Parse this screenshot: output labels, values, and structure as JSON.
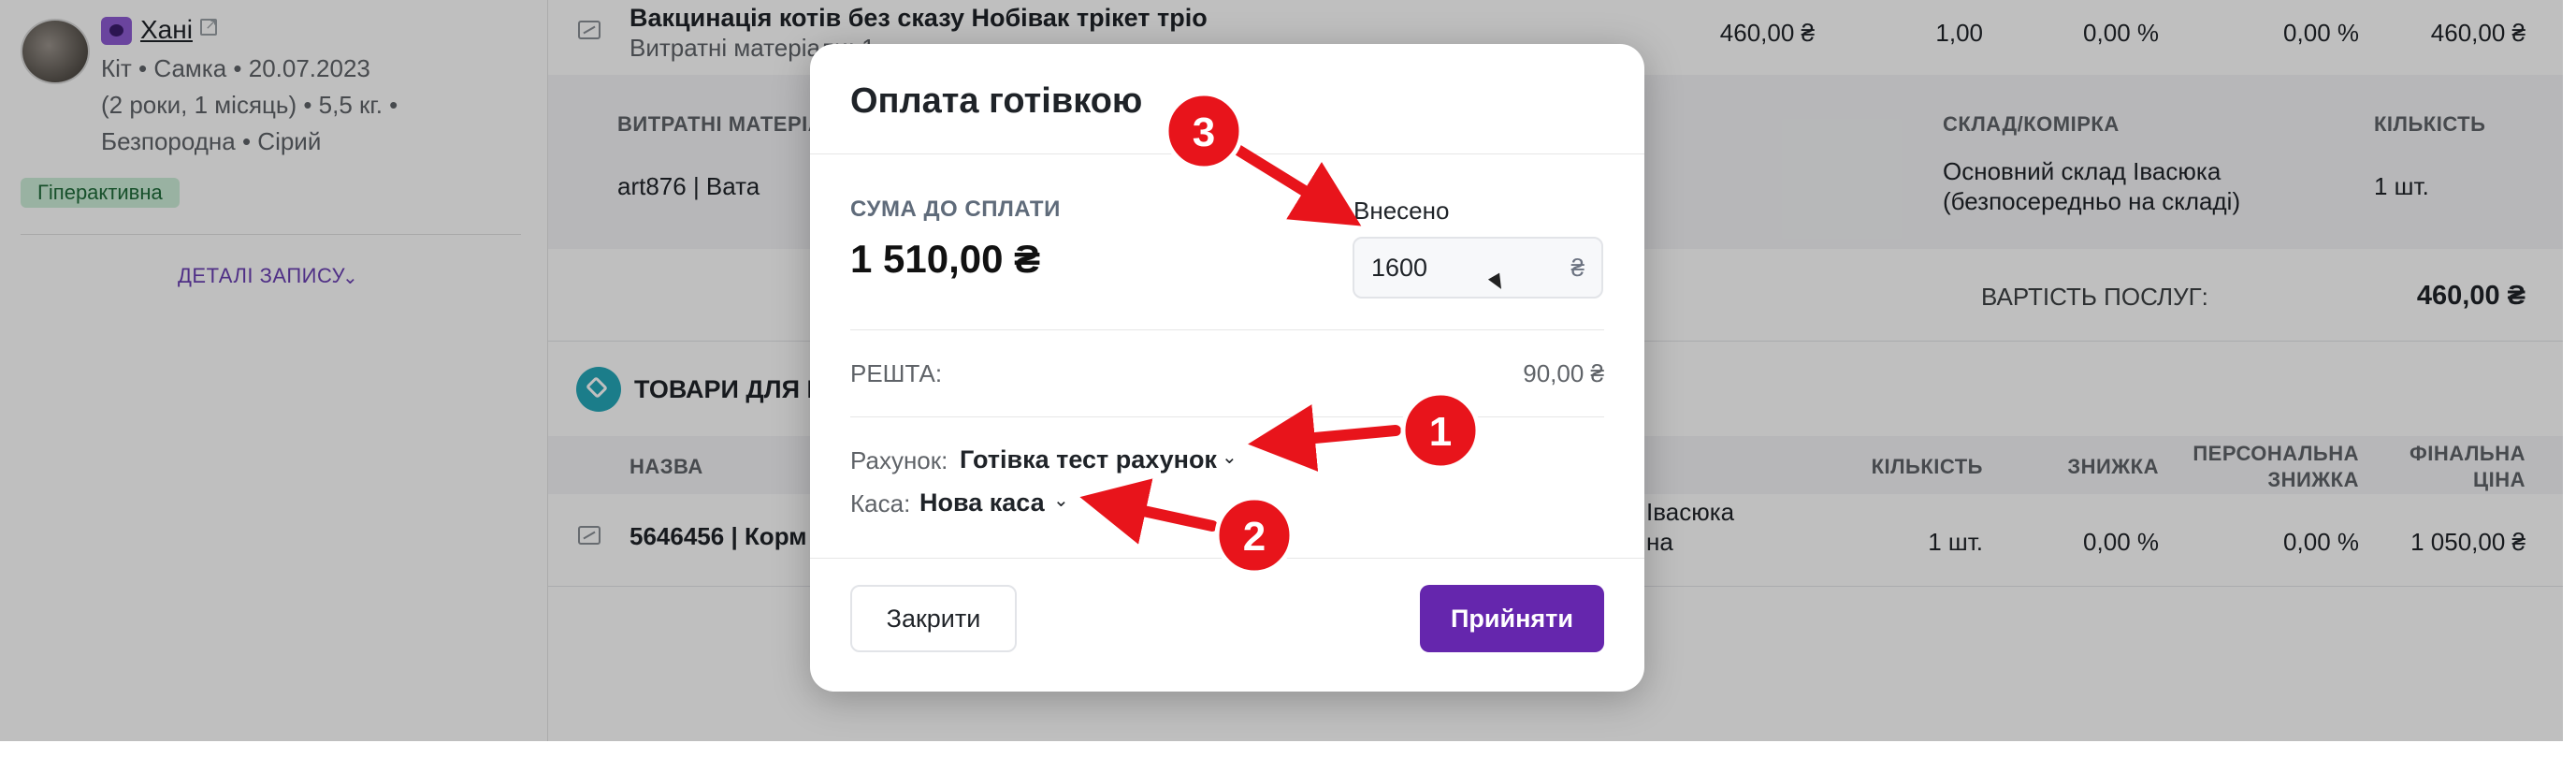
{
  "patient": {
    "name": "Хані",
    "line1": "Кіт • Самка • 20.07.2023",
    "line2": "(2 роки, 1 місяць) • 5,5 кг. •",
    "line3": "Безпородна • Сірий",
    "tag": "Гіперактивна",
    "details_link": "ДЕТАЛІ ЗАПИСУ"
  },
  "service": {
    "title": "Вакцинація котів без сказу Нобівак трікет тріо",
    "subtitle": "Витратні матеріали: 1",
    "price": "460,00 ₴",
    "qty": "1,00",
    "discount": "0,00 %",
    "personal_discount": "0,00 %",
    "total": "460,00 ₴"
  },
  "materials": {
    "headers": {
      "name": "ВИТРАТНІ МАТЕРІАЛИ",
      "warehouse": "СКЛАД/КОМІРКА",
      "qty": "КІЛЬКІСТЬ"
    },
    "item": "art876 | Вата",
    "warehouse_line1": "Основний склад Івасюка",
    "warehouse_line2": "(безпосередньо на складі)",
    "qty": "1 шт."
  },
  "services_cost": {
    "label": "ВАРТІСТЬ ПОСЛУГ:",
    "value": "460,00 ₴"
  },
  "goods": {
    "section_title": "ТОВАРИ ДЛЯ ПРОДАЖУ",
    "headers": {
      "name": "НАЗВА",
      "qty": "КІЛЬКІСТЬ",
      "discount": "ЗНИЖКА",
      "personal_line1": "ПЕРСОНАЛЬНА",
      "personal_line2": "ЗНИЖКА",
      "final_line1": "ФІНАЛЬНА",
      "final_line2": "ЦІНА"
    },
    "row": {
      "name": "5646456 | Корм",
      "warehouse_line1": "Івасюка",
      "warehouse_line2": "на",
      "qty": "1 шт.",
      "discount": "0,00 %",
      "personal_discount": "0,00 %",
      "final": "1 050,00 ₴"
    }
  },
  "modal": {
    "title": "Оплата готівкою",
    "due_label": "СУМА ДО СПЛАТИ",
    "due_amount": "1 510,00 ₴",
    "paid_label": "Внесено",
    "paid_value": "1600",
    "currency": "₴",
    "change_label": "РЕШТА:",
    "change_value": "90,00 ₴",
    "account_label": "Рахунок:",
    "account_value": "Готівка тест рахунок",
    "cashbox_label": "Каса:",
    "cashbox_value": "Нова каса",
    "close_button": "Закрити",
    "accept_button": "Прийняти"
  },
  "annotations": {
    "n1": "1",
    "n2": "2",
    "n3": "3",
    "color": "#e8141b"
  },
  "colors": {
    "accent": "#6526ad",
    "tag_bg": "#cdeed8",
    "section_icon": "#24a7b8"
  }
}
